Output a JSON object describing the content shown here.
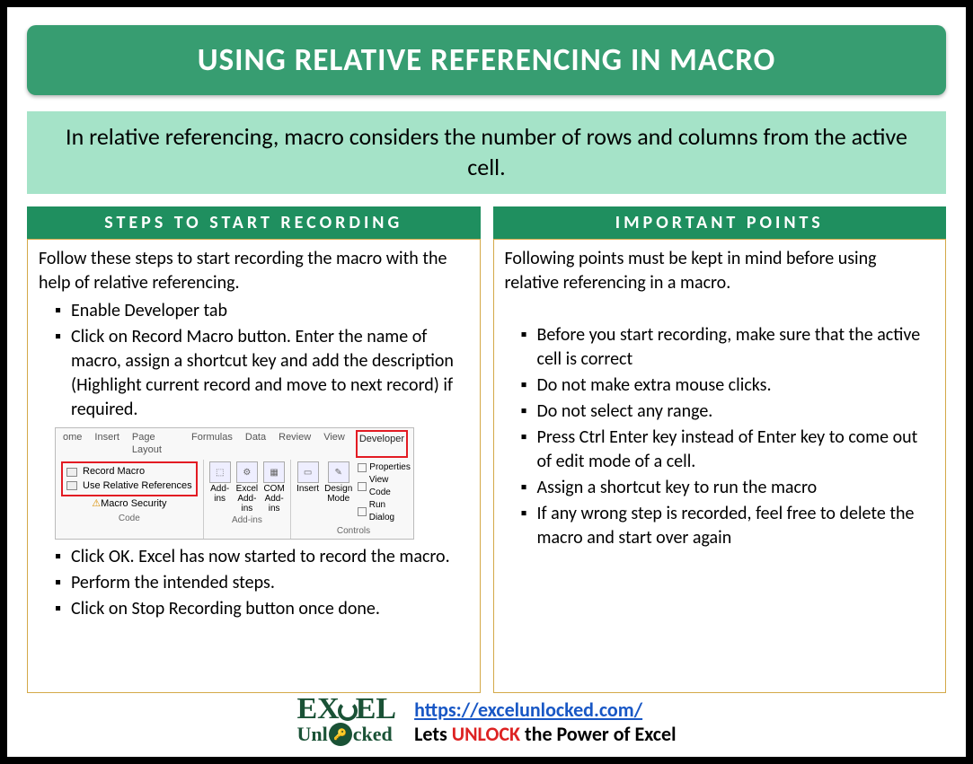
{
  "title": "USING RELATIVE REFERENCING IN MACRO",
  "intro": "In relative referencing, macro considers the number of rows and columns from the active cell.",
  "left": {
    "header": "STEPS TO START RECORDING",
    "intro": "Follow these steps to start recording the macro with the help of relative referencing.",
    "items_before": [
      "Enable Developer tab",
      "Click on Record Macro button. Enter the name of macro, assign a shortcut key and add the description (Highlight current record and move to next record) if required."
    ],
    "items_after": [
      "Click OK. Excel has now started to record the macro.",
      "Perform the intended steps.",
      "Click on Stop Recording button once done."
    ]
  },
  "right": {
    "header": "IMPORTANT POINTS",
    "intro": "Following points must be kept in mind before using relative referencing in a macro.",
    "items": [
      "Before you start recording, make sure that the active cell is correct",
      "Do not make extra mouse clicks.",
      "Do not select any range.",
      "Press Ctrl Enter key instead of Enter key to come out of edit mode of a cell.",
      "Assign a shortcut key to run the macro",
      "If any wrong step is recorded, feel free to delete the macro and start over again"
    ]
  },
  "ribbon": {
    "tabs": [
      "ome",
      "Insert",
      "Page Layout",
      "Formulas",
      "Data",
      "Review",
      "View",
      "Developer"
    ],
    "code_group": [
      "Record Macro",
      "Use Relative References",
      "Macro Security"
    ],
    "code_label": "Code",
    "addins": [
      "Add-ins",
      "Excel Add-ins",
      "COM Add-ins"
    ],
    "addins_label": "Add-ins",
    "controls_main": [
      "Insert",
      "Design Mode"
    ],
    "controls_side": [
      "Properties",
      "View Code",
      "Run Dialog"
    ],
    "controls_label": "Controls"
  },
  "footer": {
    "logo_top": "EX   EL",
    "logo_bottom_left": "Unl",
    "logo_bottom_right": "cked",
    "url": "https://excelunlocked.com/",
    "tagline_pre": "Lets ",
    "tagline_mid": "UNLOCK",
    "tagline_post": " the Power of Excel"
  }
}
